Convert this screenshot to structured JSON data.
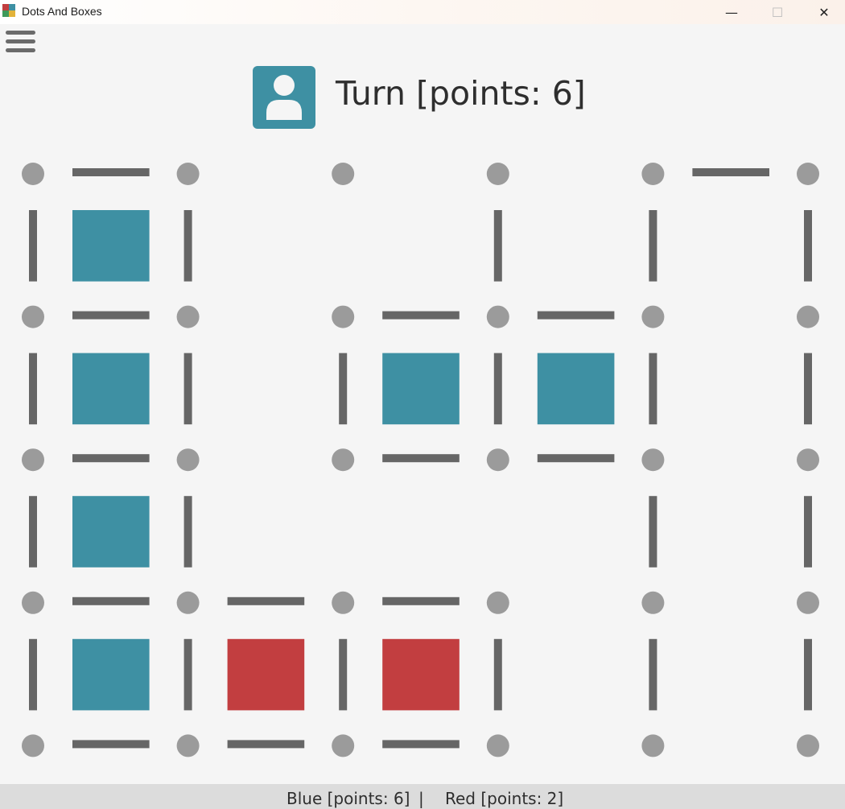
{
  "window": {
    "title": "Dots And Boxes",
    "minimize_glyph": "—",
    "maximize_glyph": "☐",
    "close_glyph": "✕"
  },
  "header": {
    "avatar_icon": "user-icon",
    "turn_text": "Turn [points: 6]"
  },
  "colors": {
    "blue": "#3e90a3",
    "red": "#c23e40",
    "line": "#666666",
    "dot": "#9b9b9b",
    "background": "#f5f5f5"
  },
  "board": {
    "dot_rows": 5,
    "dot_cols": 6,
    "h_lines": [
      [
        1,
        0,
        0,
        0,
        1
      ],
      [
        1,
        0,
        1,
        1,
        0
      ],
      [
        1,
        0,
        1,
        1,
        0
      ],
      [
        1,
        1,
        1,
        0,
        0
      ],
      [
        1,
        1,
        1,
        0,
        0
      ]
    ],
    "v_lines": [
      [
        1,
        1,
        0,
        1,
        1,
        1
      ],
      [
        1,
        1,
        1,
        1,
        1,
        1
      ],
      [
        1,
        1,
        0,
        0,
        1,
        1
      ],
      [
        1,
        1,
        1,
        1,
        1,
        1
      ]
    ],
    "boxes": [
      [
        "blue",
        "",
        "",
        "",
        ""
      ],
      [
        "blue",
        "",
        "blue",
        "blue",
        ""
      ],
      [
        "blue",
        "",
        "",
        "",
        ""
      ],
      [
        "blue",
        "red",
        "red",
        "",
        ""
      ]
    ]
  },
  "status": {
    "blue_text": "Blue [points: 6]",
    "separator": "|",
    "red_text": "Red [points: 2]"
  }
}
